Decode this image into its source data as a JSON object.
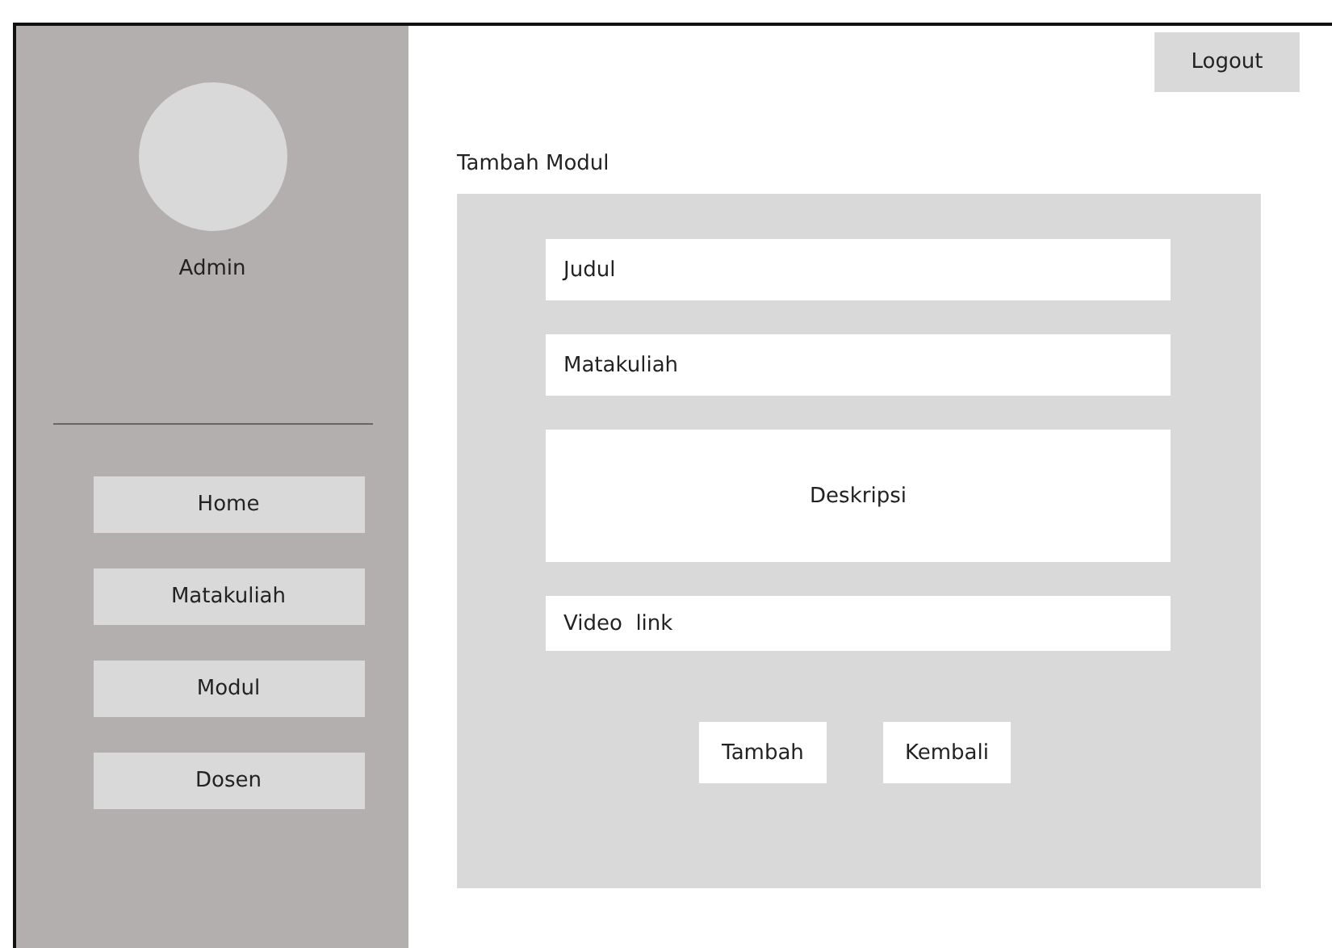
{
  "sidebar": {
    "user_name": "Admin",
    "items": [
      {
        "label": "Home"
      },
      {
        "label": "Matakuliah"
      },
      {
        "label": "Modul"
      },
      {
        "label": "Dosen"
      }
    ]
  },
  "header": {
    "logout": "Logout"
  },
  "form": {
    "title": "Tambah Modul",
    "fields": [
      {
        "kind": "text",
        "placeholder": "Judul"
      },
      {
        "kind": "text",
        "placeholder": "Matakuliah"
      },
      {
        "kind": "textarea",
        "placeholder": "Deskripsi"
      },
      {
        "kind": "text",
        "placeholder": "Video  link"
      }
    ],
    "buttons": [
      "Tambah",
      "Kembali"
    ]
  }
}
